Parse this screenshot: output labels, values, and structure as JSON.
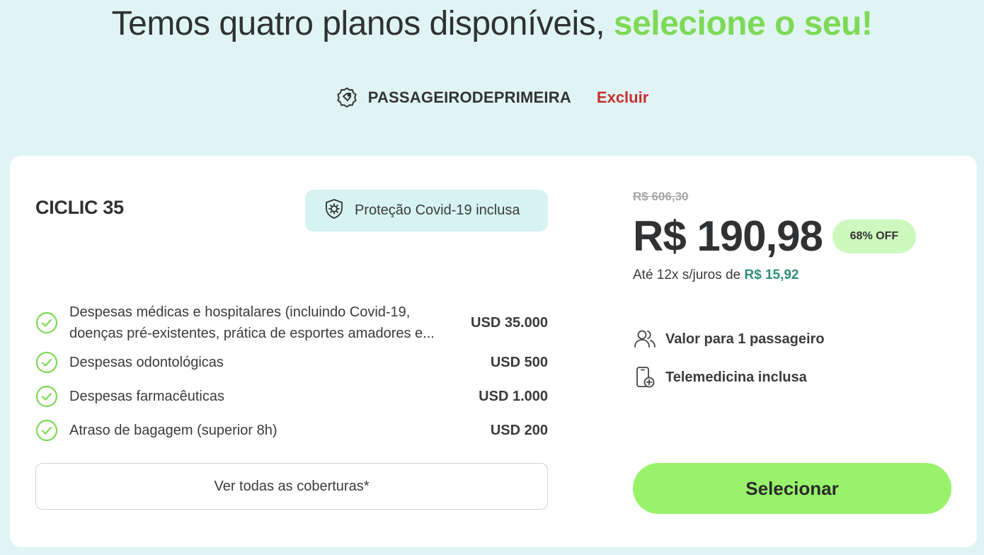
{
  "header": {
    "title_main": "Temos quatro planos disponíveis,",
    "title_highlight": "selecione o seu!"
  },
  "coupon": {
    "icon": "tag-icon",
    "code": "PASSAGEIRODEPRIMEIRA",
    "remove_label": "Excluir"
  },
  "plan": {
    "name": "CICLIC 35",
    "covid_badge": "Proteção Covid-19 inclusa",
    "coverages": [
      {
        "label": "Despesas médicas e hospitalares (incluindo Covid-19, doenças pré-existentes, prática de esportes amadores e...",
        "amount": "USD 35.000"
      },
      {
        "label": "Despesas odontológicas",
        "amount": "USD 500"
      },
      {
        "label": "Despesas farmacêuticas",
        "amount": "USD 1.000"
      },
      {
        "label": "Atraso de bagagem (superior 8h)",
        "amount": "USD 200"
      }
    ],
    "all_coverages_label": "Ver todas as coberturas*"
  },
  "pricing": {
    "old_price": "R$ 606,30",
    "price": "R$ 190,98",
    "discount": "68% OFF",
    "installments_text": "Até 12x s/juros de",
    "installments_value": "R$ 15,92",
    "features": [
      {
        "icon": "users-icon",
        "label": "Valor para 1 passageiro"
      },
      {
        "icon": "telemedicine-icon",
        "label": "Telemedicina inclusa"
      }
    ],
    "select_label": "Selecionar"
  },
  "colors": {
    "background": "#e0f5f3",
    "highlight_green": "#7ed957",
    "remove_red": "#c62f2f",
    "button_green": "#98f36a",
    "installment_teal": "#2f8f78"
  }
}
